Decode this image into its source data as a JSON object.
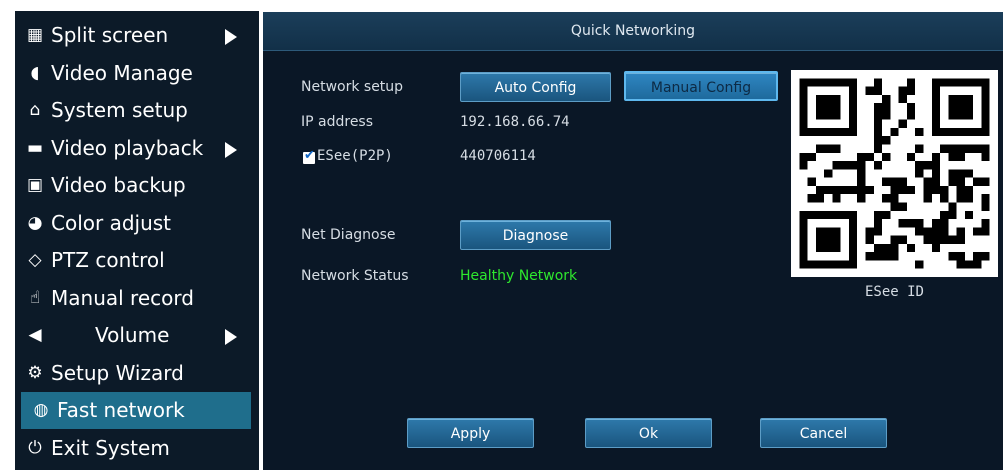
{
  "sidebar": {
    "items": [
      {
        "label": "Split screen",
        "icon": "grid-icon",
        "glyph": "▦",
        "submenu": true
      },
      {
        "label": "Video Manage",
        "icon": "camera-icon",
        "glyph": "◖",
        "submenu": false
      },
      {
        "label": "System setup",
        "icon": "home-icon",
        "glyph": "⌂",
        "submenu": false
      },
      {
        "label": "Video playback",
        "icon": "film-icon",
        "glyph": "▬",
        "submenu": true
      },
      {
        "label": "Video backup",
        "icon": "floppy-icon",
        "glyph": "▣",
        "submenu": false
      },
      {
        "label": "Color adjust",
        "icon": "color-icon",
        "glyph": "◕",
        "submenu": false
      },
      {
        "label": "PTZ control",
        "icon": "ptz-icon",
        "glyph": "◇",
        "submenu": false
      },
      {
        "label": "Manual record",
        "icon": "hand-icon",
        "glyph": "☝",
        "submenu": false
      },
      {
        "label": "Volume",
        "icon": "speaker-icon",
        "glyph": "◀",
        "submenu": true
      },
      {
        "label": "Setup Wizard",
        "icon": "gears-icon",
        "glyph": "⚙",
        "submenu": false
      },
      {
        "label": "Fast network",
        "icon": "globe-icon",
        "glyph": "◍",
        "submenu": false,
        "active": true
      },
      {
        "label": "Exit System",
        "icon": "power-icon",
        "glyph": "⏻",
        "submenu": false
      }
    ]
  },
  "dialog": {
    "title": "Quick Networking",
    "network_setup_label": "Network setup",
    "auto_config_label": "Auto Config",
    "manual_config_label": "Manual Config",
    "ip_label": "IP address",
    "ip_value": "192.168.66.74",
    "esee_label": "ESee(P2P)",
    "esee_checked": true,
    "esee_value": "440706114",
    "net_diagnose_label": "Net Diagnose",
    "diagnose_button": "Diagnose",
    "network_status_label": "Network Status",
    "network_status_value": "Healthy Network",
    "qr_caption": "ESee ID",
    "apply_label": "Apply",
    "ok_label": "Ok",
    "cancel_label": "Cancel"
  },
  "colors": {
    "sidebar_bg": "#0c1a28",
    "active_item": "#1f6e8c",
    "dialog_bg": "#0a1726",
    "button_blue": "#2e79ab",
    "status_green": "#2ee82e"
  }
}
